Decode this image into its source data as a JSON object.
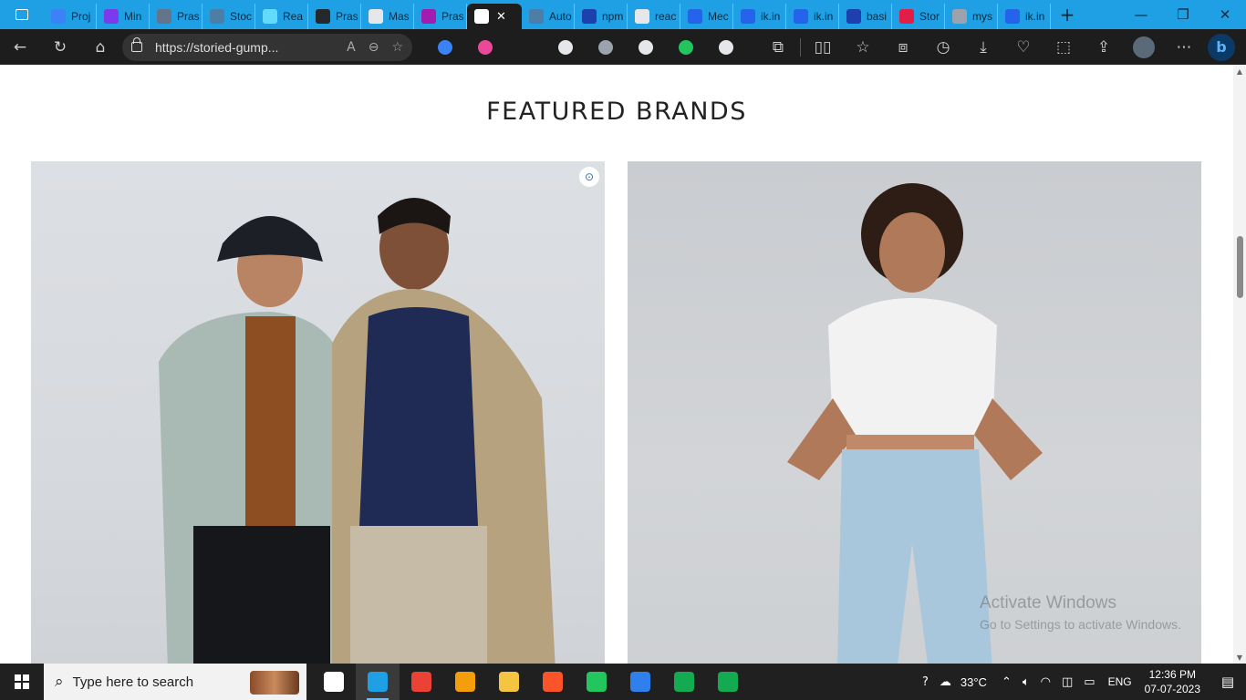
{
  "browser": {
    "tabs": [
      {
        "label": "Proj",
        "favicon_color": "#3b82f6"
      },
      {
        "label": "Min",
        "favicon_color": "#7c3aed"
      },
      {
        "label": "Pras",
        "favicon_color": "#64748b"
      },
      {
        "label": "Stoc",
        "favicon_color": "#4c7ea8"
      },
      {
        "label": "Rea",
        "favicon_color": "#61dafb"
      },
      {
        "label": "Pras",
        "favicon_color": "#24292e"
      },
      {
        "label": "Mas",
        "favicon_color": "#e5e7eb"
      },
      {
        "label": "Pras",
        "favicon_color": "#a21caf"
      },
      {
        "label": "",
        "favicon_color": "#ffffff",
        "active": true
      },
      {
        "label": "Auto",
        "favicon_color": "#4c7ea8"
      },
      {
        "label": "npm",
        "favicon_color": "#1e40af"
      },
      {
        "label": "reac",
        "favicon_color": "#e5e7eb"
      },
      {
        "label": "Mec",
        "favicon_color": "#2563eb"
      },
      {
        "label": "ik.in",
        "favicon_color": "#2563eb"
      },
      {
        "label": "ik.in",
        "favicon_color": "#2563eb"
      },
      {
        "label": "basi",
        "favicon_color": "#1e40af"
      },
      {
        "label": "Stor",
        "favicon_color": "#e11d48"
      },
      {
        "label": "mys",
        "favicon_color": "#9ca3af"
      },
      {
        "label": "ik.in",
        "favicon_color": "#2563eb"
      }
    ],
    "new_tab_symbol": "+",
    "window_controls": {
      "minimize": "—",
      "restore": "❐",
      "close": "✕"
    },
    "active_tab_close": "✕",
    "address": {
      "url": "https://storied-gump..."
    },
    "extension_colors": [
      "#3b82f6",
      "#ec4899",
      "#1d1d1d",
      "#e5e7eb",
      "#9ca3af",
      "#e5e7eb",
      "#22c55e",
      "#e5e7eb"
    ]
  },
  "page": {
    "section_title": "FEATURED BRANDS",
    "watermark": {
      "line1": "Activate Windows",
      "line2": "Go to Settings to activate Windows."
    }
  },
  "taskbar": {
    "search_placeholder": "Type here to search",
    "temperature": "33°C",
    "language": "ENG",
    "time": "12:36 PM",
    "date": "07-07-2023",
    "apps": [
      {
        "name": "task-view",
        "color": "#ffffff"
      },
      {
        "name": "edge",
        "color": "#1fa0e4",
        "active": true
      },
      {
        "name": "chrome",
        "color": "#ea4335"
      },
      {
        "name": "store",
        "color": "#f59e0b"
      },
      {
        "name": "file-explorer",
        "color": "#f5c542"
      },
      {
        "name": "brave",
        "color": "#fb542b"
      },
      {
        "name": "google-drive",
        "color": "#22c55e"
      },
      {
        "name": "vscode",
        "color": "#2f80ed"
      },
      {
        "name": "mongodb-compass",
        "color": "#13aa52"
      },
      {
        "name": "mongodb",
        "color": "#13aa52"
      }
    ]
  }
}
